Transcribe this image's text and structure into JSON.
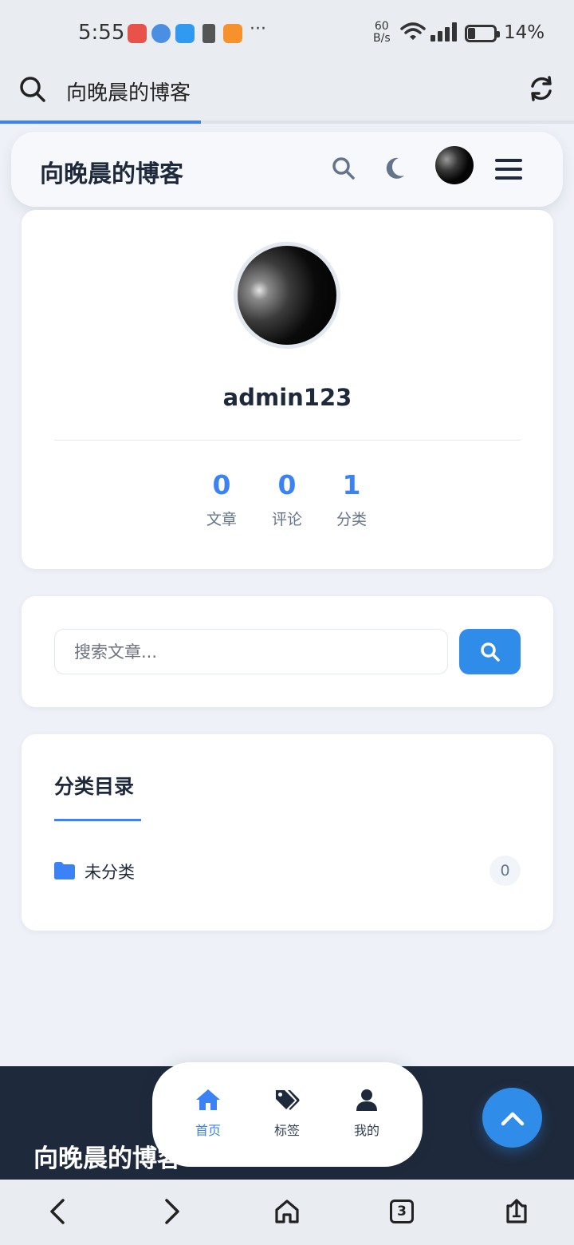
{
  "status_bar": {
    "time": "5:55",
    "net_speed_value": "60",
    "net_speed_unit": "B/s",
    "battery_percent": "14%",
    "battery_level": 0.14,
    "more": "···"
  },
  "browser": {
    "page_title": "向晚晨的博客",
    "load_progress": 0.35,
    "tab_count": "3"
  },
  "header": {
    "site_title": "向晚晨的博客"
  },
  "profile": {
    "username": "admin123",
    "stats": [
      {
        "value": "0",
        "label": "文章"
      },
      {
        "value": "0",
        "label": "评论"
      },
      {
        "value": "1",
        "label": "分类"
      }
    ]
  },
  "search": {
    "placeholder": "搜索文章..."
  },
  "categories": {
    "title": "分类目录",
    "items": [
      {
        "name": "未分类",
        "count": "0"
      }
    ]
  },
  "footer": {
    "title": "向晚晨的博客"
  },
  "bottom_nav": {
    "items": [
      {
        "label": "首页",
        "active": true
      },
      {
        "label": "标签",
        "active": false
      },
      {
        "label": "我的",
        "active": false
      }
    ]
  },
  "colors": {
    "accent": "#3b82f6",
    "button": "#2f8ce8",
    "dark": "#1e293b"
  }
}
